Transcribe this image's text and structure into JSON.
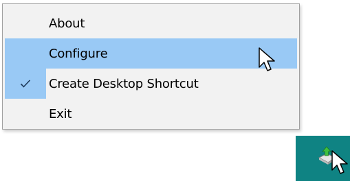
{
  "context_menu": {
    "items": [
      {
        "label": "About",
        "checked": false,
        "highlighted": false
      },
      {
        "label": "Configure",
        "checked": false,
        "highlighted": true
      },
      {
        "label": "Create Desktop Shortcut",
        "checked": true,
        "highlighted": false
      },
      {
        "label": "Exit",
        "checked": false,
        "highlighted": false
      }
    ]
  },
  "icons": {
    "checkmark": "checkmark-icon",
    "menu_cursor": "mouse-pointer-icon",
    "tray_app": "upload-arrow-app-icon",
    "tray_cursor": "mouse-pointer-icon"
  },
  "colors": {
    "menu_background": "#f2f2f2",
    "menu_border": "#a0a0a0",
    "highlight": "#99c9f5",
    "taskbar_tray": "#0f8383",
    "checkmark": "#1e3a5a"
  }
}
